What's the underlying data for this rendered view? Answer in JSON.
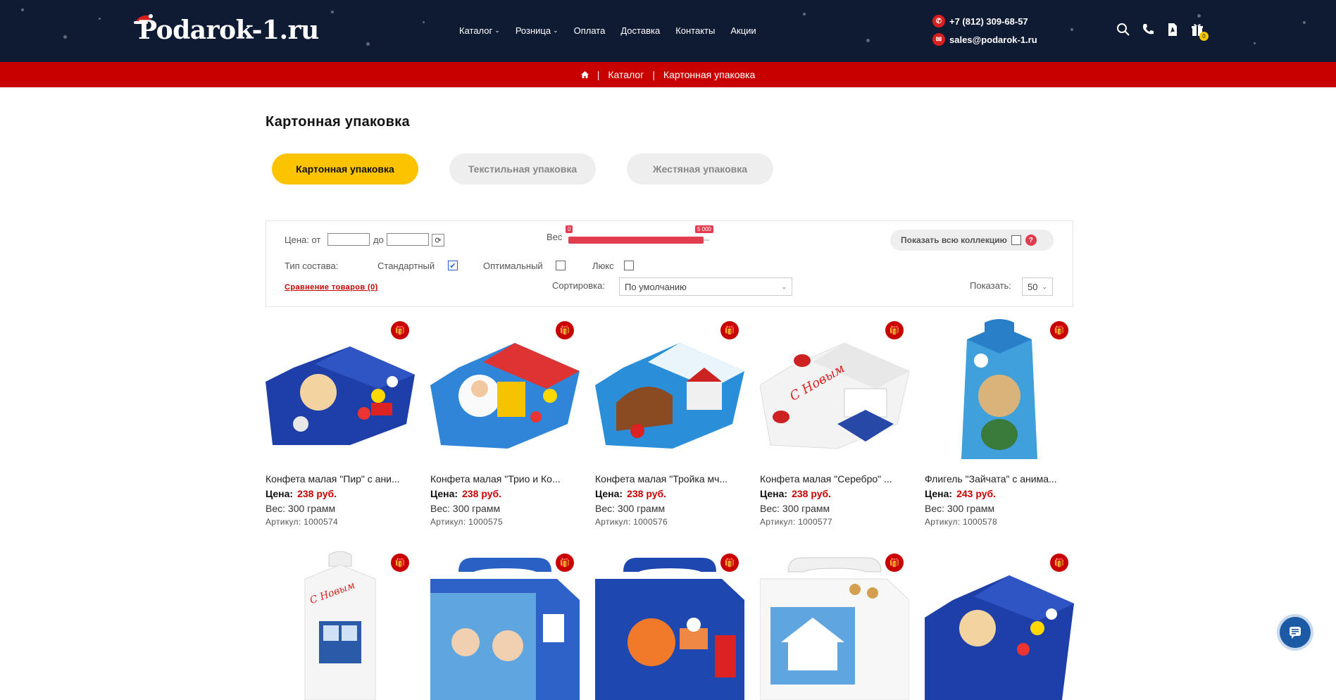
{
  "header": {
    "logo": "Podarok-1.ru",
    "nav": [
      {
        "label": "Каталог",
        "dropdown": true
      },
      {
        "label": "Розница",
        "dropdown": true
      },
      {
        "label": "Оплата",
        "dropdown": false
      },
      {
        "label": "Доставка",
        "dropdown": false
      },
      {
        "label": "Контакты",
        "dropdown": false
      },
      {
        "label": "Акции",
        "dropdown": false
      }
    ],
    "phone": "+7 (812) 309-68-57",
    "email": "sales@podarok-1.ru",
    "cart_count": "0",
    "icons": [
      "search-icon",
      "phone-icon",
      "pdf-icon",
      "cart-icon"
    ]
  },
  "breadcrumb": {
    "home_icon": "home-icon",
    "separator": "|",
    "items": [
      "Каталог",
      "Картонная упаковка"
    ]
  },
  "page_title": "Картонная упаковка",
  "tabs": [
    {
      "label": "Картонная упаковка",
      "active": true
    },
    {
      "label": "Текстильная упаковка",
      "active": false
    },
    {
      "label": "Жестяная упаковка",
      "active": false
    }
  ],
  "filter": {
    "price_from_label": "Цена: от",
    "price_to_label": "до",
    "price_from_value": "",
    "price_to_value": "",
    "weight_label": "Вес",
    "weight_min": "0",
    "weight_max": "5 000",
    "show_all_label": "Показать всю коллекцию",
    "help": "?",
    "composition_label": "Тип состава:",
    "compositions": [
      {
        "label": "Стандартный",
        "checked": true
      },
      {
        "label": "Оптимальный",
        "checked": false
      },
      {
        "label": "Люкс",
        "checked": false
      }
    ],
    "compare_link": "Сравнение товаров (0)",
    "sort_label": "Сортировка:",
    "sort_value": "По умолчанию",
    "show_label": "Показать:",
    "show_value": "50"
  },
  "products": [
    {
      "name": "Конфета малая \"Пир\" с ани...",
      "price_label": "Цена:",
      "price": "238 руб.",
      "weight": "Вес: 300 грамм",
      "sku": "Артикул: 1000574"
    },
    {
      "name": "Конфета малая \"Трио и Ко...",
      "price_label": "Цена:",
      "price": "238 руб.",
      "weight": "Вес: 300 грамм",
      "sku": "Артикул: 1000575"
    },
    {
      "name": "Конфета малая \"Тройка мч...",
      "price_label": "Цена:",
      "price": "238 руб.",
      "weight": "Вес: 300 грамм",
      "sku": "Артикул: 1000576"
    },
    {
      "name": "Конфета малая \"Серебро\" ...",
      "price_label": "Цена:",
      "price": "238 руб.",
      "weight": "Вес: 300 грамм",
      "sku": "Артикул: 1000577"
    },
    {
      "name": "Флигель \"Зайчата\" с анима...",
      "price_label": "Цена:",
      "price": "243 руб.",
      "weight": "Вес: 300 грамм",
      "sku": "Артикул: 1000578"
    }
  ],
  "colors": {
    "header_bg": "#0f1a33",
    "accent_red": "#c80000",
    "tab_active": "#fcc400",
    "chat_button": "#1c5aa6"
  }
}
